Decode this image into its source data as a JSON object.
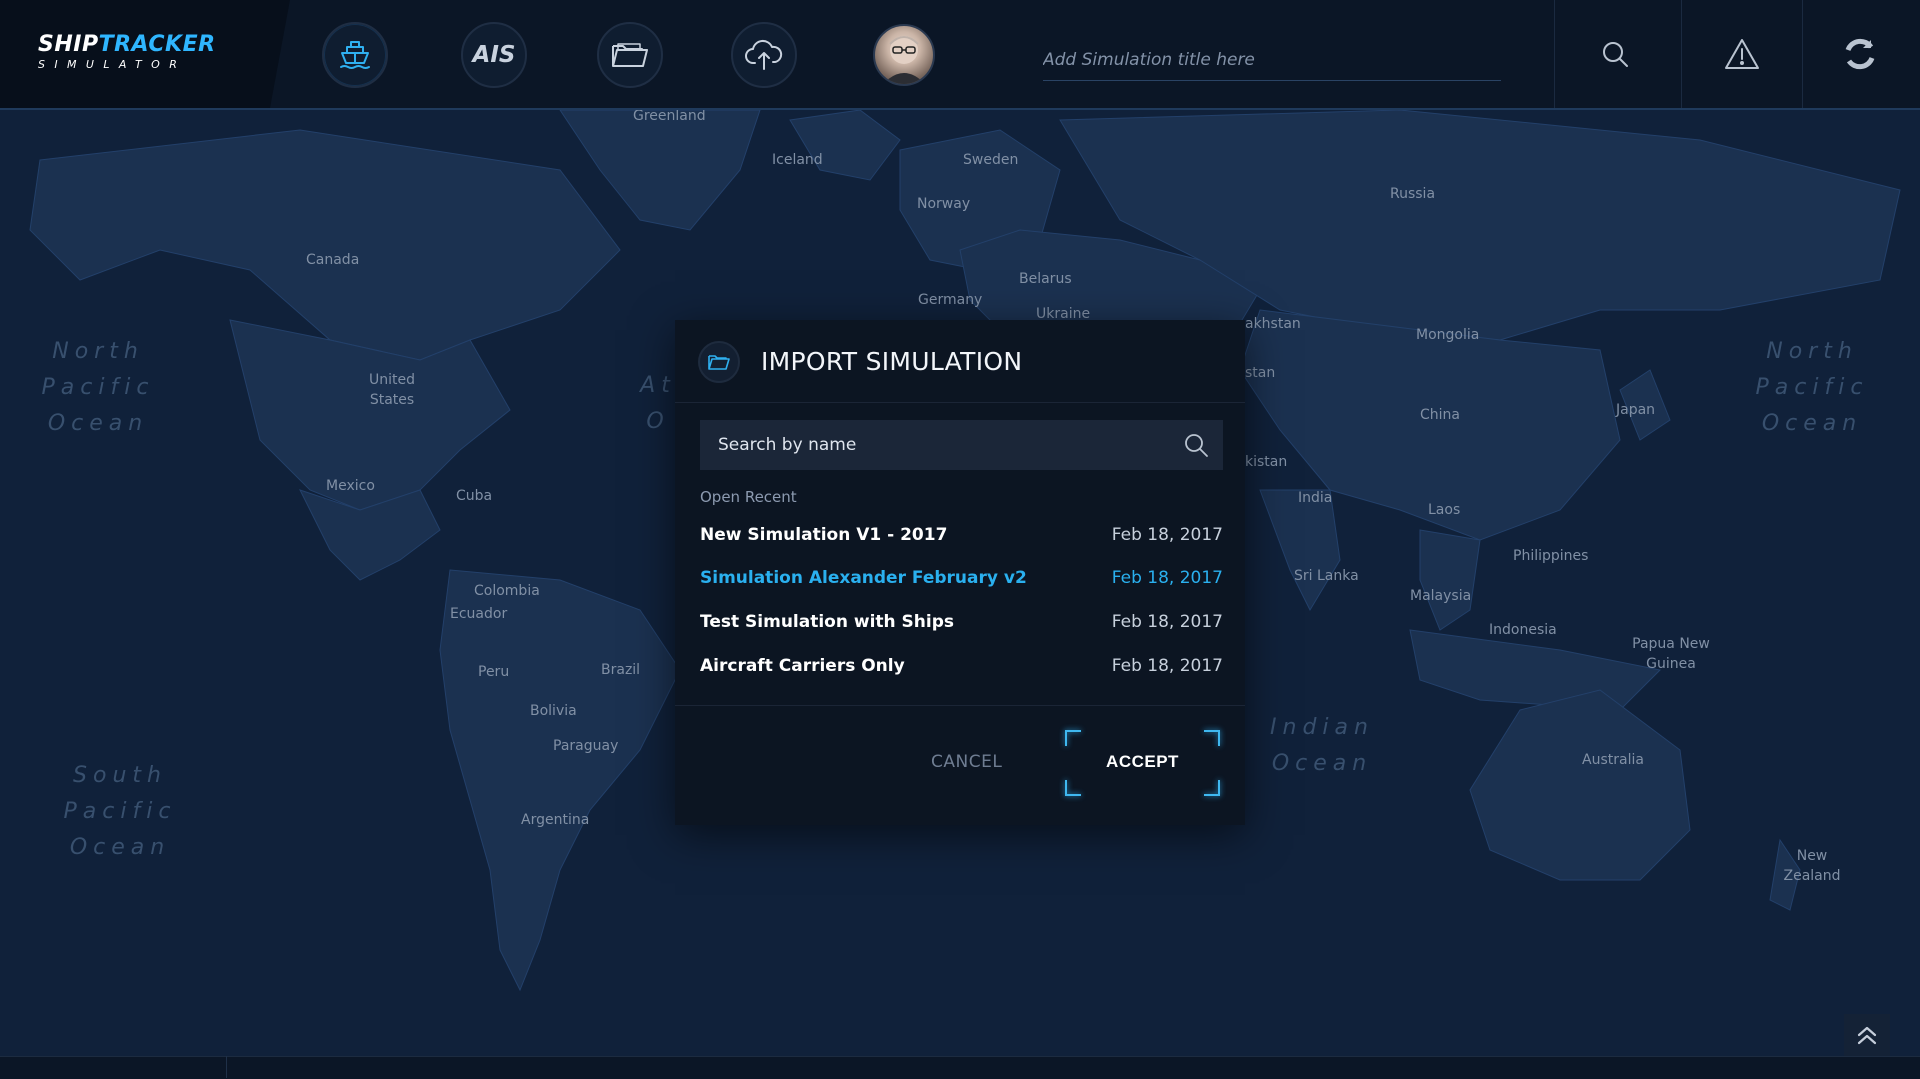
{
  "app": {
    "logo_part1": "SHIP",
    "logo_part2": "TRACKER",
    "logo_sub": "SIMULATOR"
  },
  "nav": [
    {
      "icon": "ship-icon"
    },
    {
      "icon": "ais-icon",
      "label": "AIS"
    },
    {
      "icon": "folder-icon"
    },
    {
      "icon": "cloud-upload-icon"
    }
  ],
  "title_input": {
    "placeholder": "Add Simulation title here"
  },
  "tools": [
    {
      "icon": "search-icon"
    },
    {
      "icon": "warning-icon"
    },
    {
      "icon": "sync-icon"
    }
  ],
  "map": {
    "labels": [
      "Greenland",
      "Iceland",
      "Sweden",
      "Norway",
      "Russia",
      "Canada",
      "Belarus",
      "Germany",
      "Ukraine",
      "akhstan",
      "Mongolia",
      "stan",
      "United States",
      "China",
      "Japan",
      "Mexico",
      "Cuba",
      "kistan",
      "India",
      "Laos",
      "Philippines",
      "Colombia",
      "Ecuador",
      "Sri Lanka",
      "Malaysia",
      "Indonesia",
      "Papua New Guinea",
      "Peru",
      "Brazil",
      "Bolivia",
      "Paraguay",
      "Australia",
      "Argentina",
      "New Zealand"
    ],
    "oceans": [
      {
        "lines": [
          "North",
          "Pacific",
          "Ocean"
        ]
      },
      {
        "lines": [
          "North",
          "Pacific",
          "Ocean"
        ]
      },
      {
        "lines": [
          "South",
          "Pacific",
          "Ocean"
        ]
      },
      {
        "lines": [
          "Indian",
          "Ocean"
        ]
      },
      {
        "lines": [
          "At",
          "O"
        ]
      }
    ]
  },
  "dialog": {
    "title": "IMPORT SIMULATION",
    "search_placeholder": "Search by name",
    "recent_label": "Open Recent",
    "items": [
      {
        "name": "New Simulation V1 - 2017",
        "date": "Feb 18, 2017"
      },
      {
        "name": "Simulation Alexander February v2",
        "date": "Feb 18, 2017"
      },
      {
        "name": "Test Simulation with Ships",
        "date": "Feb 18, 2017"
      },
      {
        "name": "Aircraft Carriers Only",
        "date": "Feb 18, 2017"
      }
    ],
    "cancel_label": "CANCEL",
    "accept_label": "ACCEPT"
  },
  "colors": {
    "accent": "#2ab0ef",
    "background": "#10213a",
    "topbar": "#0b1626",
    "dialog": "#0c1522"
  }
}
